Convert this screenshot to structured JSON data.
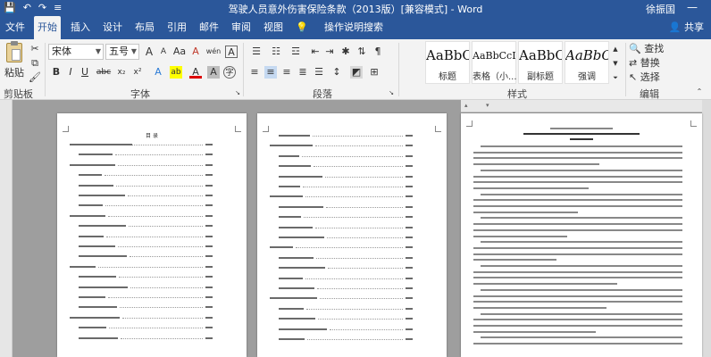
{
  "window": {
    "title": "驾驶人员意外伤害保险条款（2013版）[兼容模式] - Word",
    "user": "徐振国",
    "quick_access": [
      "💾",
      "↶",
      "↷",
      "≡"
    ],
    "minimize_glyph": "—"
  },
  "tabs": {
    "items": [
      {
        "label": "文件",
        "active": false
      },
      {
        "label": "开始",
        "active": true
      },
      {
        "label": "插入",
        "active": false
      },
      {
        "label": "设计",
        "active": false
      },
      {
        "label": "布局",
        "active": false
      },
      {
        "label": "引用",
        "active": false
      },
      {
        "label": "邮件",
        "active": false
      },
      {
        "label": "审阅",
        "active": false
      },
      {
        "label": "视图",
        "active": false
      }
    ],
    "tell_me": "操作说明搜索",
    "share": "共享"
  },
  "ribbon": {
    "clipboard": {
      "paste": "粘贴",
      "label": "剪贴板"
    },
    "font": {
      "name": "宋体",
      "size": "五号",
      "grow": "A",
      "shrink": "A",
      "case": "Aa",
      "clear": "A",
      "phonetic": "wén",
      "border": "A",
      "bold": "B",
      "italic": "I",
      "underline": "U",
      "strike": "abc",
      "sub": "x₂",
      "sup": "x²",
      "effects": "A",
      "highlight": "ab",
      "color": "A",
      "shade": "A",
      "circle": "字",
      "label": "字体"
    },
    "paragraph": {
      "label": "段落"
    },
    "styles": {
      "items": [
        {
          "sample": "AaBbC",
          "name": "标题"
        },
        {
          "sample": "AaBbCcD",
          "name": "表格（小..."
        },
        {
          "sample": "AaBbC",
          "name": "副标题"
        },
        {
          "sample": "AaBbC",
          "name": "强调"
        }
      ],
      "label": "样式"
    },
    "editing": {
      "find": "查找",
      "replace": "替换",
      "select": "选择",
      "label": "编辑"
    }
  },
  "document": {
    "page1": {
      "heading": "目  录"
    }
  },
  "colors": {
    "accent": "#2b579a",
    "ribbon_bg": "#f3f3f3",
    "canvas": "#9e9e9e"
  }
}
